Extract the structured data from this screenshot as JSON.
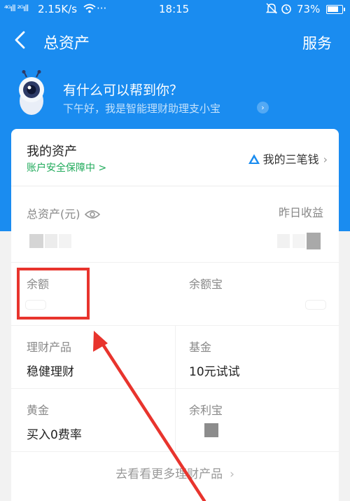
{
  "status_bar": {
    "signal": "⁴ᴳıll ²ᴳıll",
    "speed": "2.15K/s",
    "dots": "···",
    "time": "18:15",
    "battery": "73%"
  },
  "nav": {
    "title": "总资产",
    "service": "服务"
  },
  "assistant": {
    "title": "有什么可以帮到你？",
    "subtitle": "下午好，我是智能理财助理支小宝"
  },
  "card": {
    "my_assets": "我的资产",
    "security": "账户安全保障中 >",
    "three_money": "我的三笔钱",
    "total_label": "总资产(元)",
    "yesterday_label": "昨日收益",
    "items": [
      {
        "label": "余额",
        "value": ""
      },
      {
        "label": "余额宝",
        "value": ""
      },
      {
        "label": "理财产品",
        "value": "稳健理财"
      },
      {
        "label": "基金",
        "value": "10元试试"
      },
      {
        "label": "黄金",
        "value": "买入0费率"
      },
      {
        "label": "余利宝",
        "value": ""
      }
    ],
    "more": "去看看更多理财产品"
  },
  "colors": {
    "brand_blue": "#1a8cf0",
    "success_green": "#1faa5a",
    "annotation_red": "#e8342d"
  }
}
